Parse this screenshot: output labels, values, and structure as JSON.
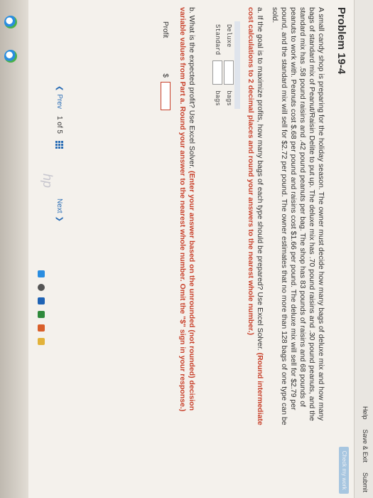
{
  "header": {
    "help_label": "Help",
    "save_exit_label": "Save & Exit",
    "submit_label": "Submit",
    "check_label": "Check my work"
  },
  "problem": {
    "title": "Problem 19-4",
    "description": "A small candy shop is preparing for the holiday season. The owner must decide how many bags of deluxe mix and how many bags of standard mix of Peanut/Raisin Delite to put up. The deluxe mix has .70 pound raisins and .30 pound peanuts, and the standard mix has .58 pound raisins and .42 pound peanuts per bag. The shop has 83 pounds of raisins and 68 pounds of peanuts to work with. Peanuts cost $.68 per pound and raisins cost $1.66 per pound. The deluxe mix will sell for $2.79 per pound, and the standard mix will sell for $2.72 per pound. The owner estimates that no more than 128 bags of one type can be sold."
  },
  "part_a": {
    "question": "a. If the goal is to maximize profits, how many bags of each type should be prepared? Use Excel Solver.",
    "instruction": "(Round intermediate cost calculations to 2 decimal places and round your answers to the nearest whole number.)",
    "rows": [
      {
        "label": "Deluxe",
        "value": "",
        "unit": "bags"
      },
      {
        "label": "Standard",
        "value": "",
        "unit": "bags"
      }
    ]
  },
  "part_b": {
    "question": "b. What is the expected profit? Use Excel Solver.",
    "instruction": "(Enter your answer based on the unrounded (not rounded) decision variable values from Part a. Round your answer to the nearest whole number. Omit the \"$\" sign in your response.)",
    "profit_label": "Profit",
    "currency": "$",
    "profit_value": ""
  },
  "pager": {
    "prev_label": "Prev",
    "current": "1",
    "of_label": "of",
    "total": "5",
    "next_label": "Next"
  },
  "brand": {
    "logo": "hp"
  }
}
